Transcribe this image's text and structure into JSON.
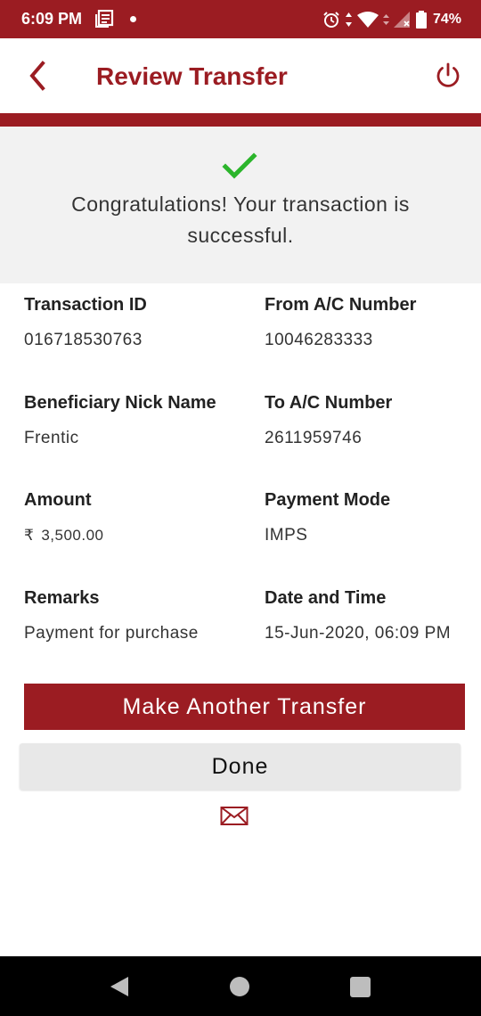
{
  "status_bar": {
    "time": "6:09 PM",
    "battery": "74%",
    "icons": [
      "news-icon",
      "notification-dot-icon",
      "alarm-icon",
      "data-arrows-icon",
      "wifi-icon",
      "signal-icon",
      "battery-icon"
    ]
  },
  "header": {
    "title": "Review Transfer",
    "back_icon": "chevron-left-icon",
    "power_icon": "power-icon"
  },
  "success": {
    "icon": "check-icon",
    "message": "Congratulations! Your transaction is successful."
  },
  "details": {
    "transaction_id": {
      "label": "Transaction ID",
      "value": "016718530763"
    },
    "from_account": {
      "label": "From A/C Number",
      "value": "10046283333"
    },
    "beneficiary": {
      "label": "Beneficiary Nick Name",
      "value": "Frentic"
    },
    "to_account": {
      "label": "To A/C Number",
      "value": "2611959746"
    },
    "amount": {
      "label": "Amount",
      "currency": "₹",
      "value": "3,500.00"
    },
    "payment_mode": {
      "label": "Payment Mode",
      "value": "IMPS"
    },
    "remarks": {
      "label": "Remarks",
      "value": "Payment for purchase"
    },
    "date_time": {
      "label": "Date and Time",
      "value": "15-Jun-2020, 06:09 PM"
    }
  },
  "actions": {
    "make_another": "Make Another Transfer",
    "done": "Done",
    "email_icon": "envelope-icon"
  },
  "colors": {
    "brand": "#9b1c22",
    "success": "#2bb52b",
    "panel": "#f2f2f2",
    "secondary_button": "#e8e8e8"
  }
}
